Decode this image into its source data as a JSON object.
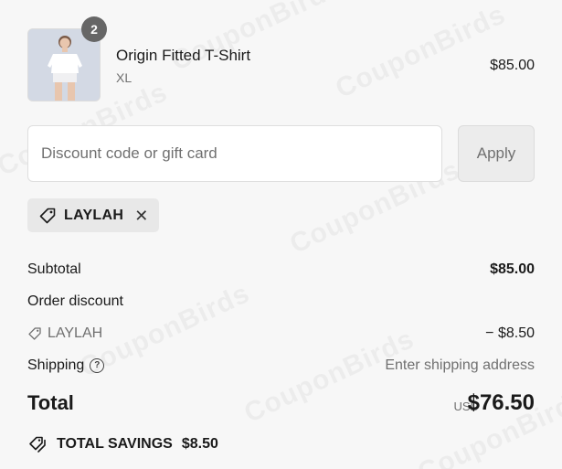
{
  "product": {
    "title": "Origin Fitted T-Shirt",
    "variant": "XL",
    "price": "$85.00",
    "quantity": "2"
  },
  "discount": {
    "placeholder": "Discount code or gift card",
    "value": "",
    "apply_label": "Apply",
    "applied_code": "LAYLAH"
  },
  "summary": {
    "subtotal_label": "Subtotal",
    "subtotal_value": "$85.00",
    "order_discount_label": "Order discount",
    "discount_code": "LAYLAH",
    "discount_value": "− $8.50",
    "shipping_label": "Shipping",
    "shipping_value": "Enter shipping address",
    "total_label": "Total",
    "currency": "USD",
    "total_value": "$76.50",
    "savings_label": "TOTAL SAVINGS",
    "savings_value": "$8.50"
  },
  "watermark": "CouponBirds",
  "colors": {
    "background": "#f7f7f7",
    "badge": "#666666",
    "muted_text": "#707070"
  }
}
